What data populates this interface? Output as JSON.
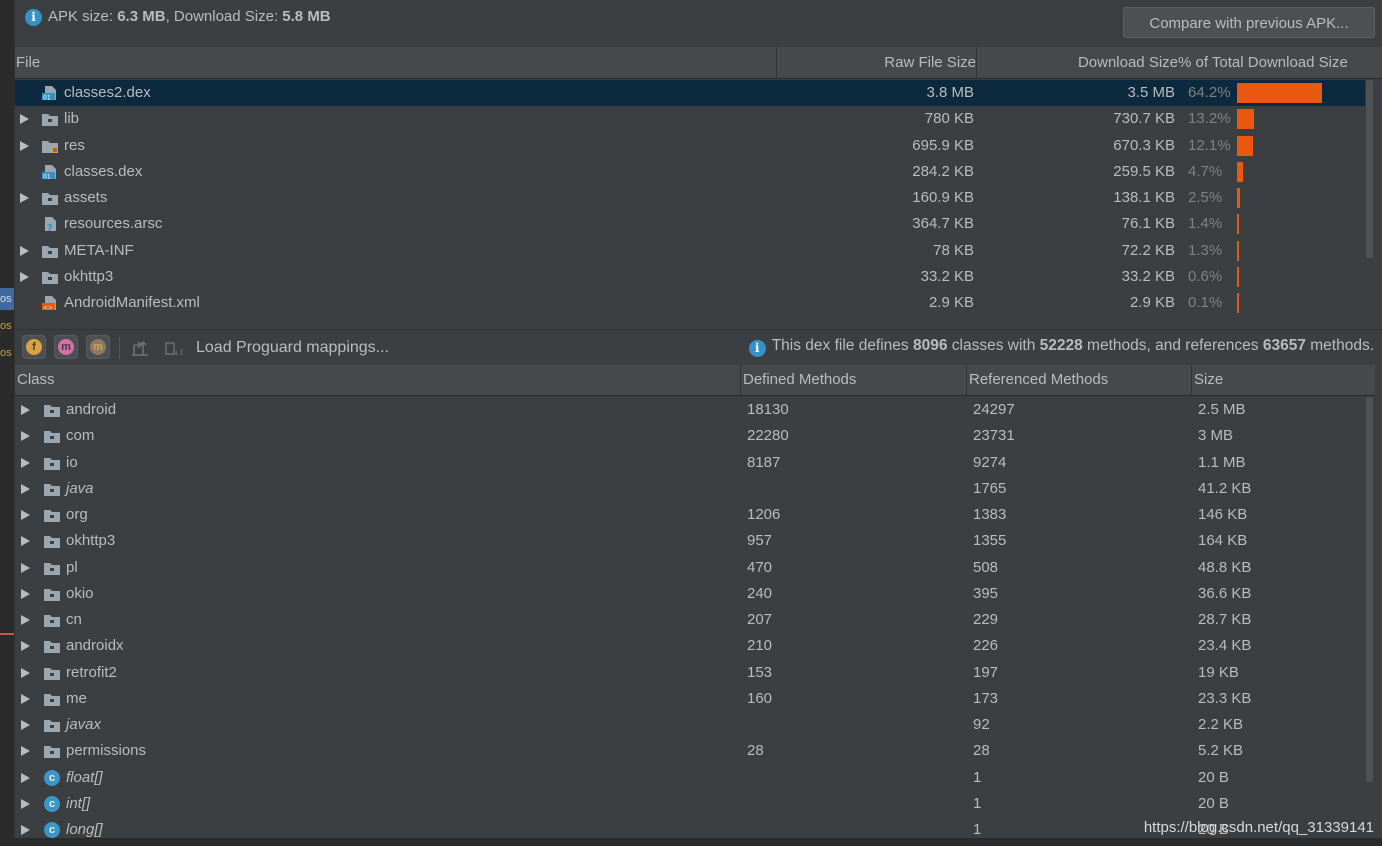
{
  "summary": {
    "apk_label": "APK size:",
    "apk_size": "6.3 MB",
    "download_label": ", Download Size:",
    "download_size": "5.8 MB",
    "compare_button": "Compare with previous APK..."
  },
  "file_table": {
    "columns": [
      "File",
      "Raw File Size",
      "Download Size",
      "% of Total Download Size"
    ],
    "rows": [
      {
        "name": "classes2.dex",
        "raw": "3.8 MB",
        "download": "3.5 MB",
        "percent": "64.2%",
        "share": 64.2,
        "expandable": false,
        "icon": "dex-file-icon",
        "selected": true
      },
      {
        "name": "lib",
        "raw": "780 KB",
        "download": "730.7 KB",
        "percent": "13.2%",
        "share": 13.2,
        "expandable": true,
        "icon": "folder-icon",
        "selected": false
      },
      {
        "name": "res",
        "raw": "695.9 KB",
        "download": "670.3 KB",
        "percent": "12.1%",
        "share": 12.1,
        "expandable": true,
        "icon": "resource-folder-icon",
        "selected": false
      },
      {
        "name": "classes.dex",
        "raw": "284.2 KB",
        "download": "259.5 KB",
        "percent": "4.7%",
        "share": 4.7,
        "expandable": false,
        "icon": "dex-file-icon",
        "selected": false
      },
      {
        "name": "assets",
        "raw": "160.9 KB",
        "download": "138.1 KB",
        "percent": "2.5%",
        "share": 2.5,
        "expandable": true,
        "icon": "folder-icon",
        "selected": false
      },
      {
        "name": "resources.arsc",
        "raw": "364.7 KB",
        "download": "76.1 KB",
        "percent": "1.4%",
        "share": 1.4,
        "expandable": false,
        "icon": "unknown-file-icon",
        "selected": false
      },
      {
        "name": "META-INF",
        "raw": "78 KB",
        "download": "72.2 KB",
        "percent": "1.3%",
        "share": 1.3,
        "expandable": true,
        "icon": "folder-icon",
        "selected": false
      },
      {
        "name": "okhttp3",
        "raw": "33.2 KB",
        "download": "33.2 KB",
        "percent": "0.6%",
        "share": 0.6,
        "expandable": true,
        "icon": "folder-icon",
        "selected": false
      },
      {
        "name": "AndroidManifest.xml",
        "raw": "2.9 KB",
        "download": "2.9 KB",
        "percent": "0.1%",
        "share": 0.1,
        "expandable": false,
        "icon": "xml-file-icon",
        "selected": false
      }
    ]
  },
  "toolbar": {
    "load_mappings": "Load Proguard mappings...",
    "dex_info_prefix": "This dex file defines ",
    "classes_count": "8096",
    "classes_mid": " classes with ",
    "methods_count": "52228",
    "methods_mid": " methods, and references ",
    "references_count": "63657",
    "references_suffix": " methods."
  },
  "class_table": {
    "columns": [
      "Class",
      "Defined Methods",
      "Referenced Methods",
      "Size"
    ],
    "rows": [
      {
        "name": "android",
        "defined": "18130",
        "referenced": "24297",
        "size": "2.5 MB",
        "kind": "package",
        "italic": false
      },
      {
        "name": "com",
        "defined": "22280",
        "referenced": "23731",
        "size": "3 MB",
        "kind": "package",
        "italic": false
      },
      {
        "name": "io",
        "defined": "8187",
        "referenced": "9274",
        "size": "1.1 MB",
        "kind": "package",
        "italic": false
      },
      {
        "name": "java",
        "defined": "",
        "referenced": "1765",
        "size": "41.2 KB",
        "kind": "package",
        "italic": true
      },
      {
        "name": "org",
        "defined": "1206",
        "referenced": "1383",
        "size": "146 KB",
        "kind": "package",
        "italic": false
      },
      {
        "name": "okhttp3",
        "defined": "957",
        "referenced": "1355",
        "size": "164 KB",
        "kind": "package",
        "italic": false
      },
      {
        "name": "pl",
        "defined": "470",
        "referenced": "508",
        "size": "48.8 KB",
        "kind": "package",
        "italic": false
      },
      {
        "name": "okio",
        "defined": "240",
        "referenced": "395",
        "size": "36.6 KB",
        "kind": "package",
        "italic": false
      },
      {
        "name": "cn",
        "defined": "207",
        "referenced": "229",
        "size": "28.7 KB",
        "kind": "package",
        "italic": false
      },
      {
        "name": "androidx",
        "defined": "210",
        "referenced": "226",
        "size": "23.4 KB",
        "kind": "package",
        "italic": false
      },
      {
        "name": "retrofit2",
        "defined": "153",
        "referenced": "197",
        "size": "19 KB",
        "kind": "package",
        "italic": false
      },
      {
        "name": "me",
        "defined": "160",
        "referenced": "173",
        "size": "23.3 KB",
        "kind": "package",
        "italic": false
      },
      {
        "name": "javax",
        "defined": "",
        "referenced": "92",
        "size": "2.2 KB",
        "kind": "package",
        "italic": true
      },
      {
        "name": "permissions",
        "defined": "28",
        "referenced": "28",
        "size": "5.2 KB",
        "kind": "package",
        "italic": false
      },
      {
        "name": "float[]",
        "defined": "",
        "referenced": "1",
        "size": "20 B",
        "kind": "class",
        "italic": true
      },
      {
        "name": "int[]",
        "defined": "",
        "referenced": "1",
        "size": "20 B",
        "kind": "class",
        "italic": true
      },
      {
        "name": "long[]",
        "defined": "",
        "referenced": "1",
        "size": "20 B",
        "kind": "class",
        "italic": true
      }
    ]
  },
  "watermark": "https://blog.csdn.net/qq_31339141",
  "left_strip_tags": [
    "os",
    "os",
    "os"
  ],
  "colors": {
    "background": "#3c3f41",
    "selection": "#0d293e",
    "bar": "#e8580e",
    "info": "#3592c4"
  }
}
